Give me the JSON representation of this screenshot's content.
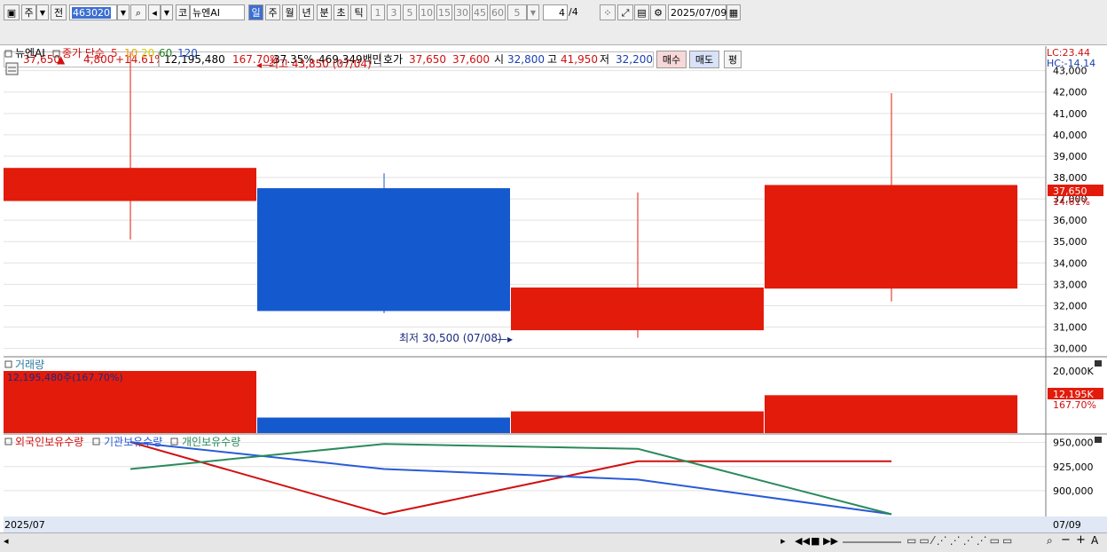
{
  "toolbar": {
    "period_select": "주",
    "full_label": "전",
    "stock_code": "463020",
    "market_label": "코",
    "stock_name": "뉴엔AI",
    "periods": [
      "일",
      "주",
      "월",
      "년",
      "분",
      "초",
      "틱"
    ],
    "active_period": "일",
    "intervals": [
      "1",
      "3",
      "5",
      "10",
      "15",
      "30",
      "45",
      "60"
    ],
    "count_value": "5",
    "page_value": "4",
    "page_total": "/4",
    "date_value": "2025/07/09"
  },
  "quote": {
    "price": "37,650",
    "change_arrow": "▲",
    "change": "4,800",
    "change_pct": "+14.61%",
    "volume": "12,195,480",
    "vol_ratio": "167.70%",
    "turnover": "37.35%",
    "amount": "469,349백만",
    "bid_ask_label": "호가",
    "ask": "37,650",
    "bid": "37,600",
    "open_label": "시",
    "open": "32,800",
    "high_label": "고",
    "high": "41,950",
    "low_label": "저",
    "low": "32,200",
    "buy_button": "매수",
    "sell_button": "매도",
    "eval_button": "평"
  },
  "legend": {
    "name": "뉴엔AI",
    "close_label": "종가 단순",
    "ma": [
      {
        "label": "5",
        "color": "#e02020"
      },
      {
        "label": "10",
        "color": "#e8a000"
      },
      {
        "label": "20",
        "color": "#d8c800"
      },
      {
        "label": "60",
        "color": "#208020"
      },
      {
        "label": "120",
        "color": "#2050c0"
      }
    ],
    "lc": "LC:23.44",
    "hc": "HC:-14.14"
  },
  "annotations": {
    "high_mark": "최고 43,850 (07/04)",
    "low_mark": "최저 30,500 (07/08)"
  },
  "volume_panel": {
    "title": "거래량",
    "info": "12,195,480주(167.70%)",
    "last_label": "12,195K",
    "last_pct": "167.70%"
  },
  "holding_panel": {
    "titles": [
      "외국인보유수량",
      "기관보유수량",
      "개인보유수량"
    ],
    "colors": [
      "#d01010",
      "#2a5bd7",
      "#2a8a5a"
    ]
  },
  "price_badge": {
    "value": "37,650",
    "pct": "14.61%"
  },
  "footer": {
    "start": "2025/07",
    "end": "07/09"
  },
  "chart_data": {
    "type": "candlestick",
    "candles": [
      {
        "open": 38450,
        "close": 36900,
        "high": 43850,
        "low": 35100,
        "color": "up"
      },
      {
        "open": 37500,
        "close": 31750,
        "high": 38200,
        "low": 31650,
        "color": "down"
      },
      {
        "open": 30850,
        "close": 32850,
        "high": 37300,
        "low": 30500,
        "color": "up"
      },
      {
        "open": 32800,
        "close": 37650,
        "high": 41950,
        "low": 32200,
        "color": "up"
      }
    ],
    "price_axis": {
      "ticks": [
        30000,
        31000,
        32000,
        33000,
        34000,
        35000,
        36000,
        37000,
        38000,
        39000,
        40000,
        41000,
        42000,
        43000
      ],
      "min": 29650,
      "max": 44150
    },
    "volume": {
      "values": [
        20000,
        5000,
        7000,
        12195
      ],
      "colors": [
        "up",
        "down",
        "up",
        "up"
      ],
      "axis_ticks": [
        20000
      ],
      "tick_labels": [
        "20,000K"
      ],
      "max": 20000
    },
    "holdings": {
      "axis_ticks": [
        900000,
        925000,
        950000
      ],
      "tick_labels": [
        "900,000",
        "925,000",
        "950,000"
      ],
      "min": 874000,
      "max": 958000,
      "series": [
        {
          "name": "외국인보유수량",
          "values": [
            950500,
            875500,
            930500,
            930500
          ],
          "color": "#d01010"
        },
        {
          "name": "기관보유수량",
          "values": [
            950500,
            922500,
            911500,
            875500
          ],
          "color": "#2a5bd7"
        },
        {
          "name": "개인보유수량",
          "values": [
            922500,
            948500,
            943500,
            875500
          ],
          "color": "#2a8a5a"
        }
      ]
    },
    "colors": {
      "up": "#e31b0b",
      "down": "#1559cf"
    }
  }
}
